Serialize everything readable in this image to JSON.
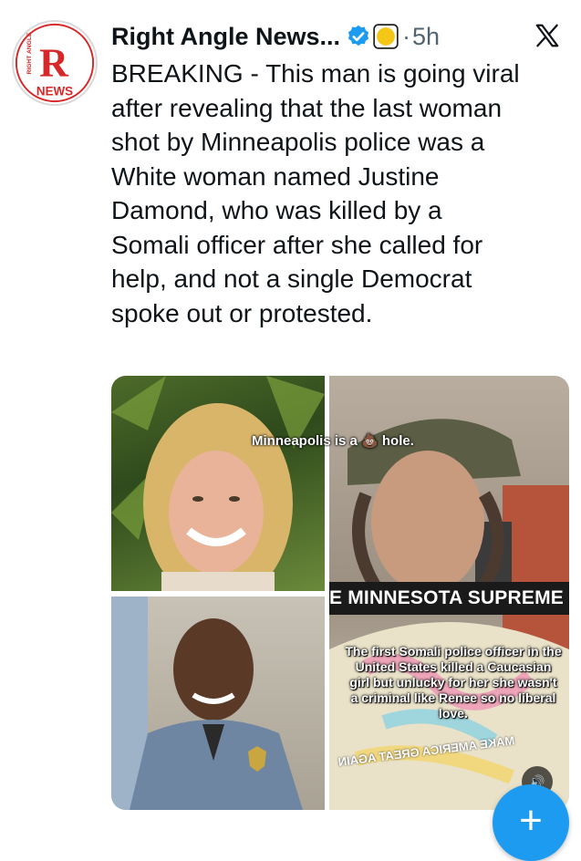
{
  "account": {
    "name": "Right Angle News...",
    "time": "5h",
    "separator": "·",
    "avatar_icon": "right-angle-news-logo",
    "logo_text_top": "RIGHT ANGLE",
    "logo_letter": "R",
    "logo_text_bottom": "NEWS",
    "verified_color": "#1d9bf0",
    "coin_color": "#f5c518"
  },
  "tweet": {
    "text": "BREAKING - This man is going viral\nafter revealing that the last woman\nshot by Minneapolis police was a\nWhite woman named Justine\nDamond, who was killed by a\nSomali officer after she called for\nhelp, and not a single Democrat\nspoke out or protested."
  },
  "media": {
    "caption_top": "Minneapolis is a 💩 hole.",
    "banner": "E MINNESOTA SUPREME COU",
    "caption_main": "The first Somali police officer in the United States killed a Caucasian girl but unlucky for her she wasn't a criminal like Renee so no liberal love.",
    "mirrored_shirt_text": "MAKE AMERICA GREAT AGAIN",
    "sound_icon": "speaker-icon",
    "sound_glyph": "🔊"
  },
  "actions": {
    "compose_glyph": "+",
    "close_glyph": "✕"
  },
  "colors": {
    "accent": "#1d9bf0",
    "text": "#0f1419",
    "muted": "#536471",
    "logo_red": "#d62828"
  }
}
